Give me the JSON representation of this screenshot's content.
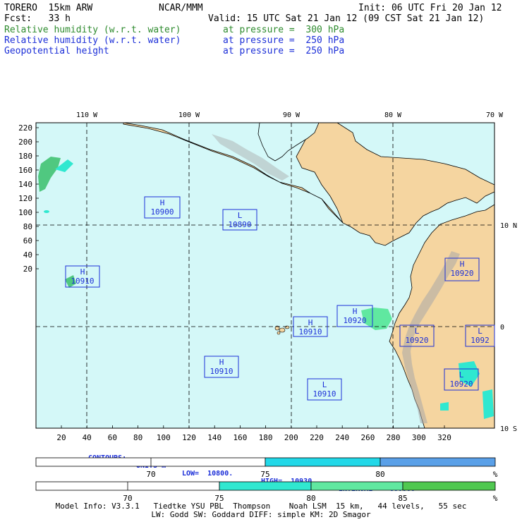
{
  "header": {
    "model": "TORERO  15km ARW",
    "center": "NCAR/MMM",
    "init": "Init: 06 UTC Fri 20 Jan 12",
    "fcst": "Fcst:   33 h",
    "valid": "Valid: 15 UTC Sat 21 Jan 12 (09 CST Sat 21 Jan 12)",
    "fields": [
      {
        "name": "Relative humidity (w.r.t. water)",
        "level": "at pressure =  300 hPa",
        "color": "#2e8b2e"
      },
      {
        "name": "Relative humidity (w.r.t. water)",
        "level": "at pressure =  250 hPa",
        "color": "#1c2fd8"
      },
      {
        "name": "Geopotential height",
        "level": "at pressure =  250 hPa",
        "color": "#1c2fd8"
      }
    ]
  },
  "map": {
    "ocean_color": "#d4f8f8",
    "land_color": "#f5d5a0",
    "top_lon_labels": [
      "110 W",
      "100 W",
      "90 W",
      "80 W",
      "70 W"
    ],
    "right_lat_labels": [
      "10 N",
      "0",
      "10 S"
    ],
    "left_ticks": [
      "220",
      "200",
      "180",
      "160",
      "140",
      "120",
      "100",
      "80",
      "60",
      "40",
      "20"
    ],
    "bottom_ticks": [
      "20",
      "40",
      "60",
      "80",
      "100",
      "120",
      "140",
      "160",
      "180",
      "200",
      "220",
      "240",
      "260",
      "280",
      "300",
      "320"
    ],
    "centers": [
      {
        "type": "H",
        "value": "10900"
      },
      {
        "type": "L",
        "value": "10890"
      },
      {
        "type": "H",
        "value": "10910"
      },
      {
        "type": "H",
        "value": "10920"
      },
      {
        "type": "H",
        "value": "10910"
      },
      {
        "type": "H",
        "value": "10920"
      },
      {
        "type": "L",
        "value": "10920"
      },
      {
        "type": "L",
        "value": "1092"
      },
      {
        "type": "H",
        "value": "10910"
      },
      {
        "type": "L",
        "value": "10920"
      },
      {
        "type": "L",
        "value": "10910"
      }
    ]
  },
  "contours": {
    "label": "CONTOURS:",
    "units": "UNITS=m",
    "low": "LOW=  10800.",
    "high": "HIGH=  10930.",
    "interval": "INTERVAL=   60.000"
  },
  "legend1": {
    "ticks": [
      "70",
      "75",
      "80"
    ],
    "unit": "%",
    "colors": [
      "#ffffff",
      "#22d8e8",
      "#5aa0e8"
    ]
  },
  "legend2": {
    "ticks": [
      "70",
      "75",
      "80",
      "85"
    ],
    "unit": "%",
    "colors": [
      "#ffffff",
      "#30e8d0",
      "#60e8a0",
      "#50c850"
    ]
  },
  "footer": {
    "line1": "Model Info: V3.3.1   Tiedtke YSU PBL  Thompson    Noah LSM  15 km,   44 levels,   55 sec",
    "line2": "LW: Godd SW: Goddard DIFF: simple KM: 2D Smagor"
  }
}
